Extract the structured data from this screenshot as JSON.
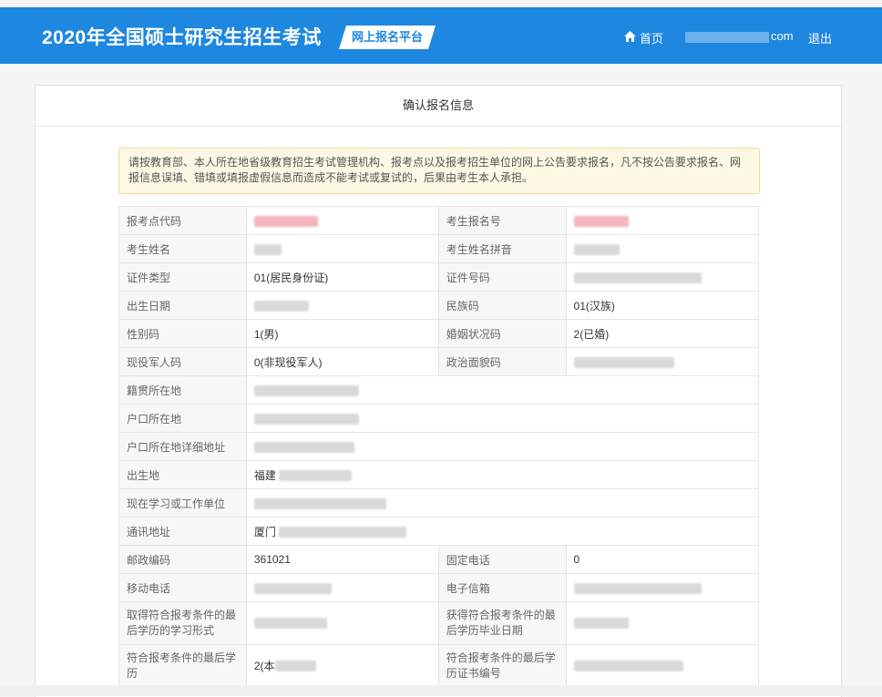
{
  "header": {
    "title": "2020年全国硕士研究生招生考试",
    "badge": "网上报名平台",
    "home": "首页",
    "user_suffix": "com",
    "logout": "退出"
  },
  "card": {
    "title": "确认报名信息",
    "notice": "请按教育部、本人所在地省级教育招生考试管理机构、报考点以及报考招生单位的网上公告要求报名，凡不按公告要求报名、网报信息误填、错填或填报虚假信息而造成不能考试或复试的，后果由考生本人承担。"
  },
  "rows": [
    {
      "l1": "报考点代码",
      "v1": "",
      "l2": "考生报名号",
      "v2": ""
    },
    {
      "l1": "考生姓名",
      "v1": "",
      "l2": "考生姓名拼音",
      "v2": ""
    },
    {
      "l1": "证件类型",
      "v1": "01(居民身份证)",
      "l2": "证件号码",
      "v2": ""
    },
    {
      "l1": "出生日期",
      "v1": "",
      "l2": "民族码",
      "v2": "01(汉族)"
    },
    {
      "l1": "性别码",
      "v1": "1(男)",
      "l2": "婚姻状况码",
      "v2": "2(已婚)"
    },
    {
      "l1": "现役军人码",
      "v1": "0(非现役军人)",
      "l2": "政治面貌码",
      "v2": ""
    },
    {
      "l1": "籍贯所在地",
      "v1": ""
    },
    {
      "l1": "户口所在地",
      "v1": ""
    },
    {
      "l1": "户口所在地详细地址",
      "v1": ""
    },
    {
      "l1": "出生地",
      "v1": "福建"
    },
    {
      "l1": "现在学习或工作单位",
      "v1": ""
    },
    {
      "l1": "通讯地址",
      "v1": "厦门"
    },
    {
      "l1": "邮政编码",
      "v1": "361021",
      "l2": "固定电话",
      "v2": "0"
    },
    {
      "l1": "移动电话",
      "v1": "",
      "l2": "电子信箱",
      "v2": ""
    },
    {
      "l1": "取得符合报考条件的最后学历的学习形式",
      "v1": "",
      "l2": "获得符合报考条件的最后学历毕业日期",
      "v2": ""
    },
    {
      "l1": "符合报考条件的最后学历",
      "v1": "2(本",
      "l2": "符合报考条件的最后学历证书编号",
      "v2": ""
    }
  ],
  "colors": {
    "header_bg": "#1e87e0",
    "notice_bg": "#fcf8e3",
    "notice_border": "#f3d79c"
  },
  "icons": {
    "home": "home-icon"
  }
}
